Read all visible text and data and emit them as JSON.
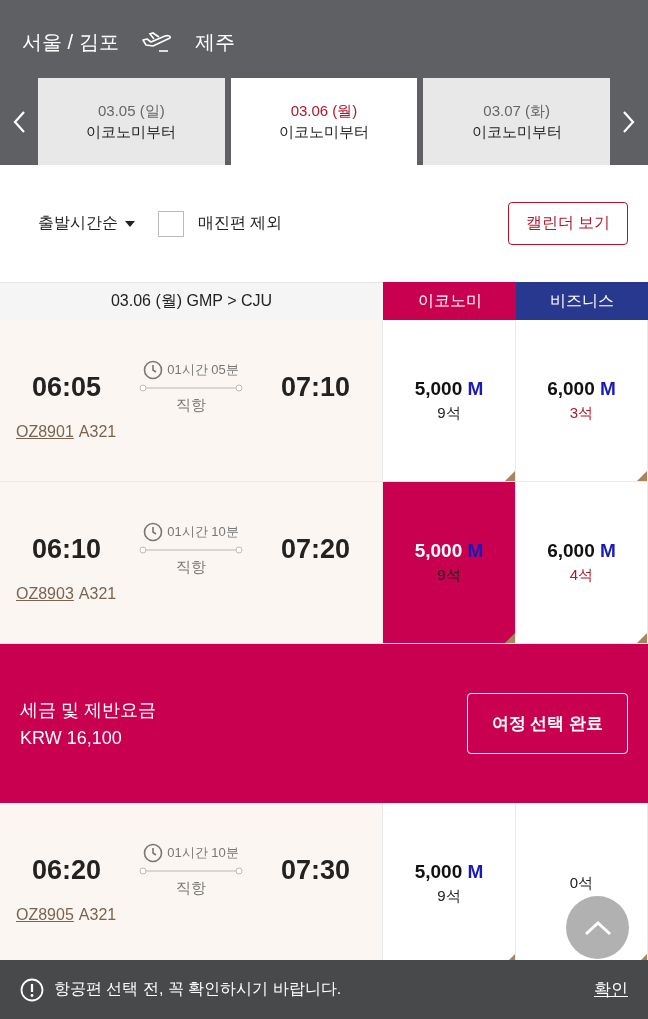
{
  "header": {
    "origin": "서울 / 김포",
    "destination": "제주"
  },
  "date_tabs": [
    {
      "date": "03.05 (일)",
      "label": "이코노미부터",
      "selected": false
    },
    {
      "date": "03.06 (월)",
      "label": "이코노미부터",
      "selected": true
    },
    {
      "date": "03.07 (화)",
      "label": "이코노미부터",
      "selected": false
    }
  ],
  "filters": {
    "sort": "출발시간순",
    "exclude_sold_out": {
      "label": "매진편 제외",
      "checked": false
    },
    "calendar_button": "캘린더 보기"
  },
  "table": {
    "route": "03.06 (월) GMP > CJU",
    "columns": [
      "이코노미",
      "비즈니스"
    ]
  },
  "rows": [
    {
      "kind": "flight",
      "departure": "06:05",
      "arrival": "07:10",
      "duration": "01시간 05분",
      "stops": "직항",
      "flight_no": "OZ8901",
      "aircraft": "A321",
      "fares": [
        {
          "price": "5,000",
          "unit": "M",
          "seats": "9석",
          "limited": false,
          "selected": false
        },
        {
          "price": "6,000",
          "unit": "M",
          "seats": "3석",
          "limited": true,
          "selected": false
        }
      ]
    },
    {
      "kind": "flight",
      "departure": "06:10",
      "arrival": "07:20",
      "duration": "01시간 10분",
      "stops": "직항",
      "flight_no": "OZ8903",
      "aircraft": "A321",
      "fares": [
        {
          "price": "5,000",
          "unit": "M",
          "seats": "9석",
          "limited": false,
          "selected": true
        },
        {
          "price": "6,000",
          "unit": "M",
          "seats": "4석",
          "limited": true,
          "selected": false
        }
      ]
    },
    {
      "kind": "summary",
      "label": "세금 및 제반요금",
      "amount": "KRW 16,100",
      "button": "여정 선택 완료"
    },
    {
      "kind": "flight",
      "departure": "06:20",
      "arrival": "07:30",
      "duration": "01시간 10분",
      "stops": "직항",
      "flight_no": "OZ8905",
      "aircraft": "A321",
      "fares": [
        {
          "price": "5,000",
          "unit": "M",
          "seats": "9석",
          "limited": false,
          "selected": false
        },
        {
          "seats": "0석",
          "limited": false,
          "selected": false
        }
      ]
    }
  ],
  "notice": {
    "text": "항공편 선택 전, 꼭 확인하시기 바랍니다.",
    "action": "확인"
  }
}
